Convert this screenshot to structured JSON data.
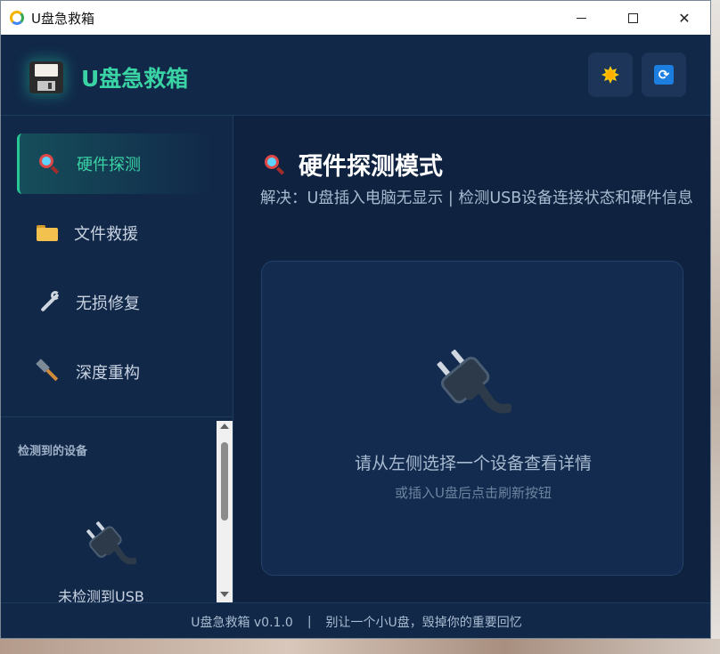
{
  "window": {
    "title": "U盘急救箱"
  },
  "header": {
    "app_name": "U盘急救箱",
    "theme_icon": "sun-icon",
    "refresh_icon": "refresh-icon"
  },
  "sidebar": {
    "items": [
      {
        "label": "硬件探测",
        "icon": "magnifier-icon",
        "active": true
      },
      {
        "label": "文件救援",
        "icon": "folder-icon",
        "active": false
      },
      {
        "label": "无损修复",
        "icon": "wrench-icon",
        "active": false
      },
      {
        "label": "深度重构",
        "icon": "hammer-icon",
        "active": false
      }
    ],
    "devices_title": "检测到的设备",
    "no_device_text": "未检测到USB"
  },
  "main": {
    "title": "硬件探测模式",
    "description": "解决：U盘插入电脑无显示 | 检测USB设备连接状态和硬件信息",
    "empty_message": "请从左侧选择一个设备查看详情",
    "empty_hint": "或插入U盘后点击刷新按钮"
  },
  "footer": {
    "version": "U盘急救箱 v0.1.0",
    "separator": "|",
    "slogan": "别让一个小U盘，毁掉你的重要回忆"
  }
}
